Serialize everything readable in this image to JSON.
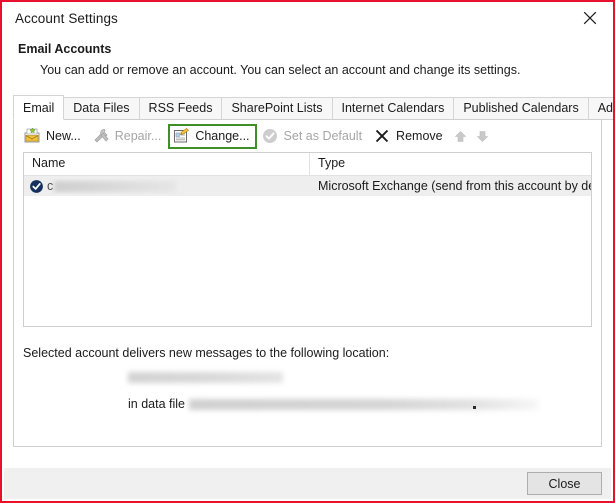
{
  "window": {
    "title": "Account Settings",
    "close_icon": "close-x-icon",
    "accent_border": "#e8112d"
  },
  "intro": {
    "heading": "Email Accounts",
    "description": "You can add or remove an account. You can select an account and change its settings."
  },
  "tabs": [
    {
      "label": "Email",
      "active": true
    },
    {
      "label": "Data Files",
      "active": false
    },
    {
      "label": "RSS Feeds",
      "active": false
    },
    {
      "label": "SharePoint Lists",
      "active": false
    },
    {
      "label": "Internet Calendars",
      "active": false
    },
    {
      "label": "Published Calendars",
      "active": false
    },
    {
      "label": "Address Books",
      "active": false
    }
  ],
  "toolbar": {
    "highlight_color": "#3f8f29",
    "items": [
      {
        "label": "New...",
        "icon": "new-mail-icon",
        "disabled": false,
        "highlighted": false
      },
      {
        "label": "Repair...",
        "icon": "repair-tools-icon",
        "disabled": true,
        "highlighted": false
      },
      {
        "label": "Change...",
        "icon": "change-form-icon",
        "disabled": false,
        "highlighted": true
      },
      {
        "label": "Set as Default",
        "icon": "set-default-check-icon",
        "disabled": true,
        "highlighted": false
      },
      {
        "label": "Remove",
        "icon": "remove-x-icon",
        "disabled": false,
        "highlighted": false
      }
    ],
    "move_up_icon": "arrow-up-icon",
    "move_down_icon": "arrow-down-icon"
  },
  "accounts_list": {
    "columns": [
      "Name",
      "Type"
    ],
    "rows": [
      {
        "badge_icon": "default-account-check-icon",
        "name_visible": "c",
        "name_redacted": true,
        "type": "Microsoft Exchange (send from this account by def..."
      }
    ]
  },
  "delivery": {
    "label": "Selected account delivers new messages to the following location:",
    "location_redacted": true,
    "data_file_prefix": "in data file",
    "data_file_redacted": true
  },
  "footer": {
    "close_label": "Close"
  }
}
